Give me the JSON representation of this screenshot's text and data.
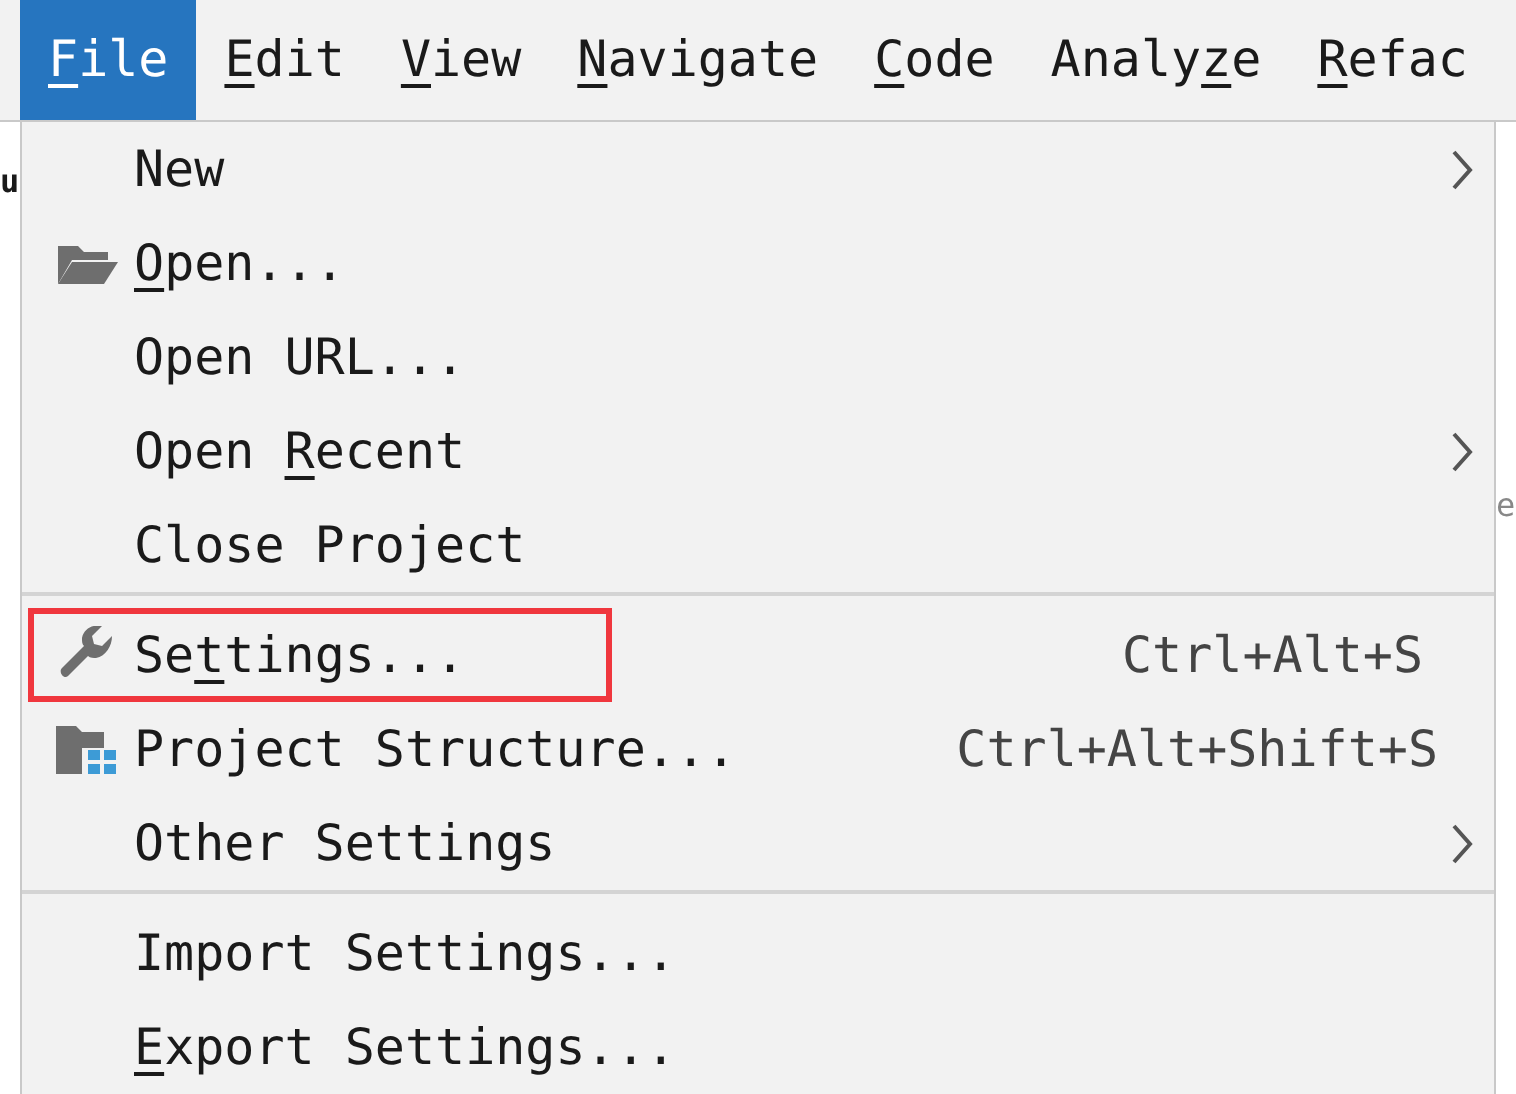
{
  "menu_bar": [
    {
      "label_parts": [
        {
          "text": "F",
          "underlined": true
        },
        {
          "text": "ile",
          "underlined": false
        }
      ],
      "selected": true
    },
    {
      "label_parts": [
        {
          "text": "E",
          "underlined": true
        },
        {
          "text": "dit",
          "underlined": false
        }
      ],
      "selected": false
    },
    {
      "label_parts": [
        {
          "text": "V",
          "underlined": true
        },
        {
          "text": "iew",
          "underlined": false
        }
      ],
      "selected": false
    },
    {
      "label_parts": [
        {
          "text": "N",
          "underlined": true
        },
        {
          "text": "avigate",
          "underlined": false
        }
      ],
      "selected": false
    },
    {
      "label_parts": [
        {
          "text": "C",
          "underlined": true
        },
        {
          "text": "ode",
          "underlined": false
        }
      ],
      "selected": false
    },
    {
      "label_parts": [
        {
          "text": "Analy",
          "underlined": false
        },
        {
          "text": "z",
          "underlined": true
        },
        {
          "text": "e",
          "underlined": false
        }
      ],
      "selected": false
    },
    {
      "label_parts": [
        {
          "text": "R",
          "underlined": true
        },
        {
          "text": "efac",
          "underlined": false
        }
      ],
      "selected": false
    }
  ],
  "background_fragments": [
    {
      "text": "u"
    },
    {
      "text": "e"
    }
  ],
  "file_menu": {
    "groups": [
      [
        {
          "label_parts": [
            {
              "text": "New",
              "underlined": false
            }
          ],
          "submenu": true
        },
        {
          "label_parts": [
            {
              "text": "O",
              "underlined": true
            },
            {
              "text": "pen...",
              "underlined": false
            }
          ],
          "submenu": false
        },
        {
          "label_parts": [
            {
              "text": "Open URL...",
              "underlined": false
            }
          ],
          "submenu": false
        },
        {
          "label_parts": [
            {
              "text": "Open ",
              "underlined": false
            },
            {
              "text": "R",
              "underlined": true
            },
            {
              "text": "ecent",
              "underlined": false
            }
          ],
          "submenu": true
        },
        {
          "label_parts": [
            {
              "text": "Close Project",
              "underlined": false
            }
          ],
          "submenu": false
        }
      ],
      [
        {
          "label_parts": [
            {
              "text": "Se",
              "underlined": false
            },
            {
              "text": "t",
              "underlined": true
            },
            {
              "text": "tings...",
              "underlined": false
            }
          ],
          "shortcut": "Ctrl+Alt+S",
          "highlighted": true,
          "submenu": false
        },
        {
          "label_parts": [
            {
              "text": "Project Structure...",
              "underlined": false
            }
          ],
          "shortcut": "Ctrl+Alt+Shift+S",
          "highlighted": false,
          "submenu": false
        },
        {
          "label_parts": [
            {
              "text": "Other Settings",
              "underlined": false
            }
          ],
          "highlighted": false,
          "submenu": true
        }
      ],
      [
        {
          "label_parts": [
            {
              "text": "Import Settings...",
              "underlined": false
            }
          ],
          "submenu": false
        },
        {
          "label_parts": [
            {
              "text": "E",
              "underlined": true
            },
            {
              "text": "xport Settings...",
              "underlined": false
            }
          ],
          "submenu": false
        }
      ]
    ]
  }
}
